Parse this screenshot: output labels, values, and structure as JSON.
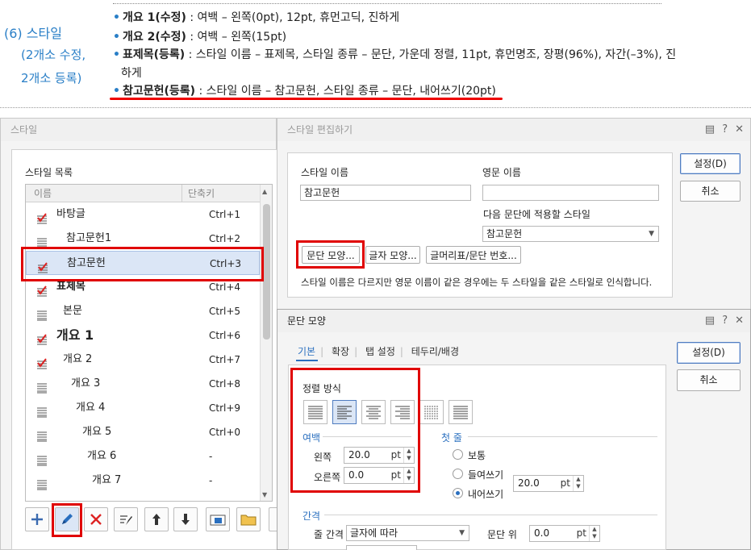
{
  "doc": {
    "section_title": "(6) 스타일",
    "section_sub1": "(2개소 수정,",
    "section_sub2": "2개소 등록)",
    "lines": [
      {
        "bold": "개요 1(수정)",
        "rest": " : 여백 – 왼쪽(0pt), 12pt, 휴먼고딕, 진하게"
      },
      {
        "bold": "개요 2(수정)",
        "rest": " : 여백 – 왼쪽(15pt)"
      },
      {
        "bold": "표제목(등록)",
        "rest": " : 스타일 이름 – 표제목, 스타일 종류 – 문단, 가운데 정렬, 11pt, 휴먼명조, 장평(96%), 자간(–3%), 진"
      },
      {
        "bold": "",
        "rest": "하게"
      },
      {
        "bold": "참고문헌(등록)",
        "rest": " : 스타일 이름 – 참고문헌, 스타일 종류 – 문단, 내어쓰기(20pt)"
      }
    ],
    "accent_color": "#2a7fc7",
    "highlight_color": "#e00000"
  },
  "style_dialog": {
    "title": "스타일",
    "list_label": "스타일 목록",
    "col_name": "이름",
    "col_key": "단축키",
    "items": [
      {
        "name": "바탕글",
        "key": "Ctrl+1",
        "icon": "paragraph-check-icon"
      },
      {
        "name": "참고문헌1",
        "key": "Ctrl+2",
        "icon": "paragraph-lines-icon"
      },
      {
        "name": "참고문헌",
        "key": "Ctrl+3",
        "icon": "paragraph-check-icon"
      },
      {
        "name": "표제목",
        "key": "Ctrl+4",
        "icon": "paragraph-check-icon"
      },
      {
        "name": "본문",
        "key": "Ctrl+5",
        "icon": "paragraph-lines-icon"
      },
      {
        "name": "개요 1",
        "key": "Ctrl+6",
        "icon": "paragraph-check-icon"
      },
      {
        "name": "개요 2",
        "key": "Ctrl+7",
        "icon": "paragraph-check-icon"
      },
      {
        "name": "개요 3",
        "key": "Ctrl+8",
        "icon": "paragraph-lines-icon"
      },
      {
        "name": "개요 4",
        "key": "Ctrl+9",
        "icon": "paragraph-lines-icon"
      },
      {
        "name": "개요 5",
        "key": "Ctrl+0",
        "icon": "paragraph-lines-icon"
      },
      {
        "name": "개요 6",
        "key": "-",
        "icon": "paragraph-lines-icon"
      },
      {
        "name": "개요 7",
        "key": "-",
        "icon": "paragraph-lines-icon"
      }
    ],
    "selected_index": 2
  },
  "edit_dialog": {
    "title": "스타일 편집하기",
    "style_name_label": "스타일 이름",
    "style_name_value": "참고문헌",
    "english_name_label": "영문 이름",
    "english_name_value": "",
    "next_style_label": "다음 문단에 적용할 스타일",
    "next_style_value": "참고문헌",
    "btn_para": "문단 모양...",
    "btn_char": "글자 모양...",
    "btn_bullet": "글머리표/문단 번호...",
    "note": "스타일 이름은 다르지만 영문 이름이 같은 경우에는 두 스타일을 같은 스타일로 인식합니다.",
    "ok": "설정(D)",
    "cancel": "취소"
  },
  "para_dialog": {
    "title": "문단 모양",
    "tabs": [
      "기본",
      "확장",
      "탭 설정",
      "테두리/배경"
    ],
    "align_label": "정렬 방식",
    "margin_label": "여백",
    "left_label": "왼쪽",
    "left_value": "20.0",
    "right_label": "오른쪽",
    "right_value": "0.0",
    "unit": "pt",
    "first_line_label": "첫 줄",
    "radio_normal": "보통",
    "radio_indent": "들여쓰기",
    "radio_hanging": "내어쓰기",
    "hanging_value": "20.0",
    "spacing_label": "간격",
    "line_spacing_label": "줄 간격",
    "line_spacing_value": "글자에 따라",
    "para_above_label": "문단 위",
    "para_above_value": "0.0",
    "ok": "설정(D)",
    "cancel": "취소"
  }
}
